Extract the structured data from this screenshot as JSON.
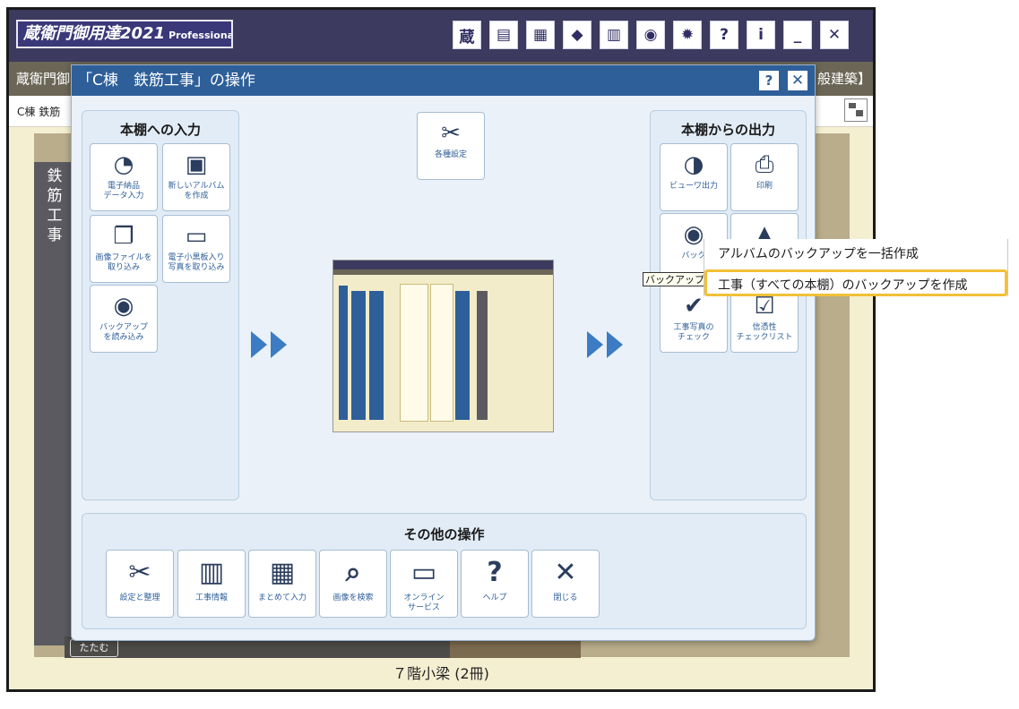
{
  "app": {
    "title": "蔵衛門御用達2021",
    "title_suffix": "Professional"
  },
  "toolbar": {
    "buttons": [
      {
        "name": "kura-cloud-icon",
        "glyph": "蔵"
      },
      {
        "name": "window-icon",
        "glyph": "▤"
      },
      {
        "name": "calendar-board-icon",
        "glyph": "▦"
      },
      {
        "name": "split-arrows-icon",
        "glyph": "◆"
      },
      {
        "name": "building-info-icon",
        "glyph": "▥"
      },
      {
        "name": "backup-disc-icon",
        "glyph": "◉"
      },
      {
        "name": "gear-icon",
        "glyph": "✹"
      },
      {
        "name": "help-book-icon",
        "glyph": "?"
      },
      {
        "name": "info-icon",
        "glyph": "i"
      },
      {
        "name": "minimize-icon",
        "glyph": "_"
      },
      {
        "name": "close-icon",
        "glyph": "✕"
      }
    ]
  },
  "subbar": {
    "left_text": "蔵衛門御",
    "right_text": "般建築】"
  },
  "crumb": {
    "text": "C棟 鉄筋"
  },
  "shelf": {
    "spine_text": "鉄筋工事",
    "close_label": "たたむ",
    "label": "７階小梁 (2冊)"
  },
  "dialog": {
    "title": "「C棟　鉄筋工事」の操作",
    "help": "?",
    "close": "✕",
    "input_panel": {
      "title": "本棚への入力",
      "tiles": [
        {
          "label": "電子納品\nデータ入力",
          "glyph": "◔"
        },
        {
          "label": "新しいアルバム\nを作成",
          "glyph": "▣"
        },
        {
          "label": "画像ファイルを\n取り込み",
          "glyph": "❐"
        },
        {
          "label": "電子小黒板入り\n写真を取り込み",
          "glyph": "▭"
        },
        {
          "label": "バックアップ\nを読み込み",
          "glyph": "◉"
        }
      ]
    },
    "settings_tile": {
      "label": "各種設定",
      "glyph": "✂"
    },
    "output_panel": {
      "title": "本棚からの出力",
      "tiles": [
        {
          "label": "ビューワ出力",
          "glyph": "◑"
        },
        {
          "label": "印刷",
          "glyph": "⎙"
        },
        {
          "label": "バック",
          "glyph": "◉"
        },
        {
          "label": "",
          "glyph": "▲"
        },
        {
          "label": "工事写真の\nチェック",
          "glyph": "✔"
        },
        {
          "label": "信憑性\nチェックリスト",
          "glyph": "☑"
        }
      ]
    },
    "other_panel": {
      "title": "その他の操作",
      "buttons": [
        {
          "label": "設定と整理",
          "glyph": "✂"
        },
        {
          "label": "工事情報",
          "glyph": "▥"
        },
        {
          "label": "まとめて入力",
          "glyph": "▦"
        },
        {
          "label": "画像を検索",
          "glyph": "⌕"
        },
        {
          "label": "オンライン\nサービス",
          "glyph": "▭"
        },
        {
          "label": "ヘルプ",
          "glyph": "?"
        },
        {
          "label": "閉じる",
          "glyph": "✕"
        }
      ]
    }
  },
  "tooltip": {
    "text": "バックアップ"
  },
  "context_menu": {
    "items": [
      {
        "label": "アルバムのバックアップを一括作成"
      },
      {
        "label": "工事（すべての本棚）のバックアップを作成"
      }
    ]
  },
  "colors": {
    "dialog_title_bg": "#2e5f99",
    "highlight_border": "#f2c037",
    "arrow": "#3b7cc4"
  }
}
